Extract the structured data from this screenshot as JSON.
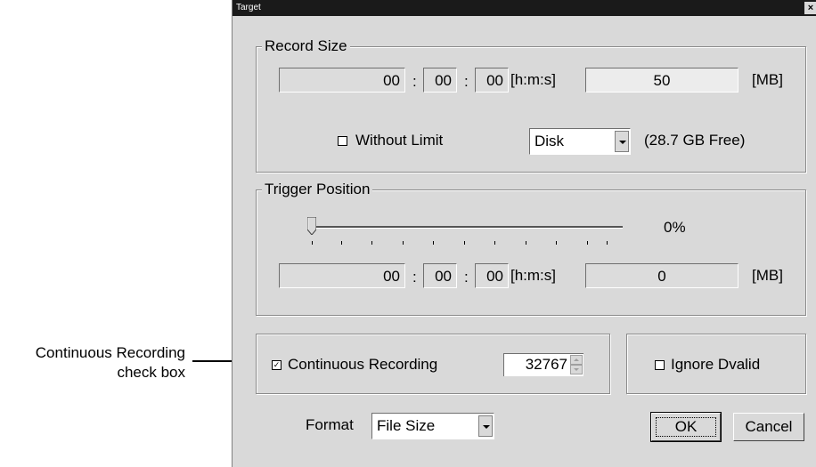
{
  "callout": {
    "line1": "Continuous Recording",
    "line2": "check box"
  },
  "window": {
    "title": "Target",
    "close": "×"
  },
  "record_size": {
    "legend": "Record Size",
    "hours": "00",
    "minutes": "00",
    "seconds": "00",
    "hms_unit": "[h:m:s]",
    "size_value": "50",
    "size_unit": "[MB]",
    "without_limit_label": "Without Limit",
    "without_limit_checked": false,
    "drive_value": "Disk",
    "free_space": "(28.7 GB Free)"
  },
  "trigger_position": {
    "legend": "Trigger Position",
    "percent": "0%",
    "slider_fraction": 0,
    "hours": "00",
    "minutes": "00",
    "seconds": "00",
    "hms_unit": "[h:m:s]",
    "size_value": "0",
    "size_unit": "[MB]"
  },
  "continuous": {
    "label": "Continuous Recording",
    "checked": true,
    "check_mark": "✓",
    "count": "32767"
  },
  "ignore_dvalid": {
    "label": "Ignore Dvalid",
    "checked": false
  },
  "format": {
    "label": "Format",
    "value": "File Size"
  },
  "buttons": {
    "ok": "OK",
    "cancel": "Cancel"
  },
  "separator": ":"
}
